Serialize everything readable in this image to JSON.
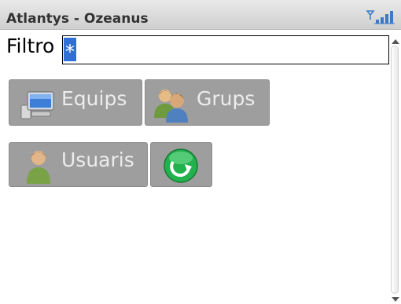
{
  "titlebar": {
    "title": "Atlantys - Ozeanus",
    "signal_icon": "signal-strength-icon"
  },
  "filter": {
    "label": "Filtro",
    "value": "*"
  },
  "buttons": {
    "equips": {
      "label": "Equips",
      "icon": "computer-icon"
    },
    "grups": {
      "label": "Grups",
      "icon": "users-group-icon"
    },
    "usuaris": {
      "label": "Usuaris",
      "icon": "user-icon"
    },
    "refresh": {
      "icon": "refresh-icon"
    }
  },
  "colors": {
    "button_bg": "#9e9e9e",
    "selection": "#2f6fd6",
    "refresh_green": "#22b14c"
  }
}
